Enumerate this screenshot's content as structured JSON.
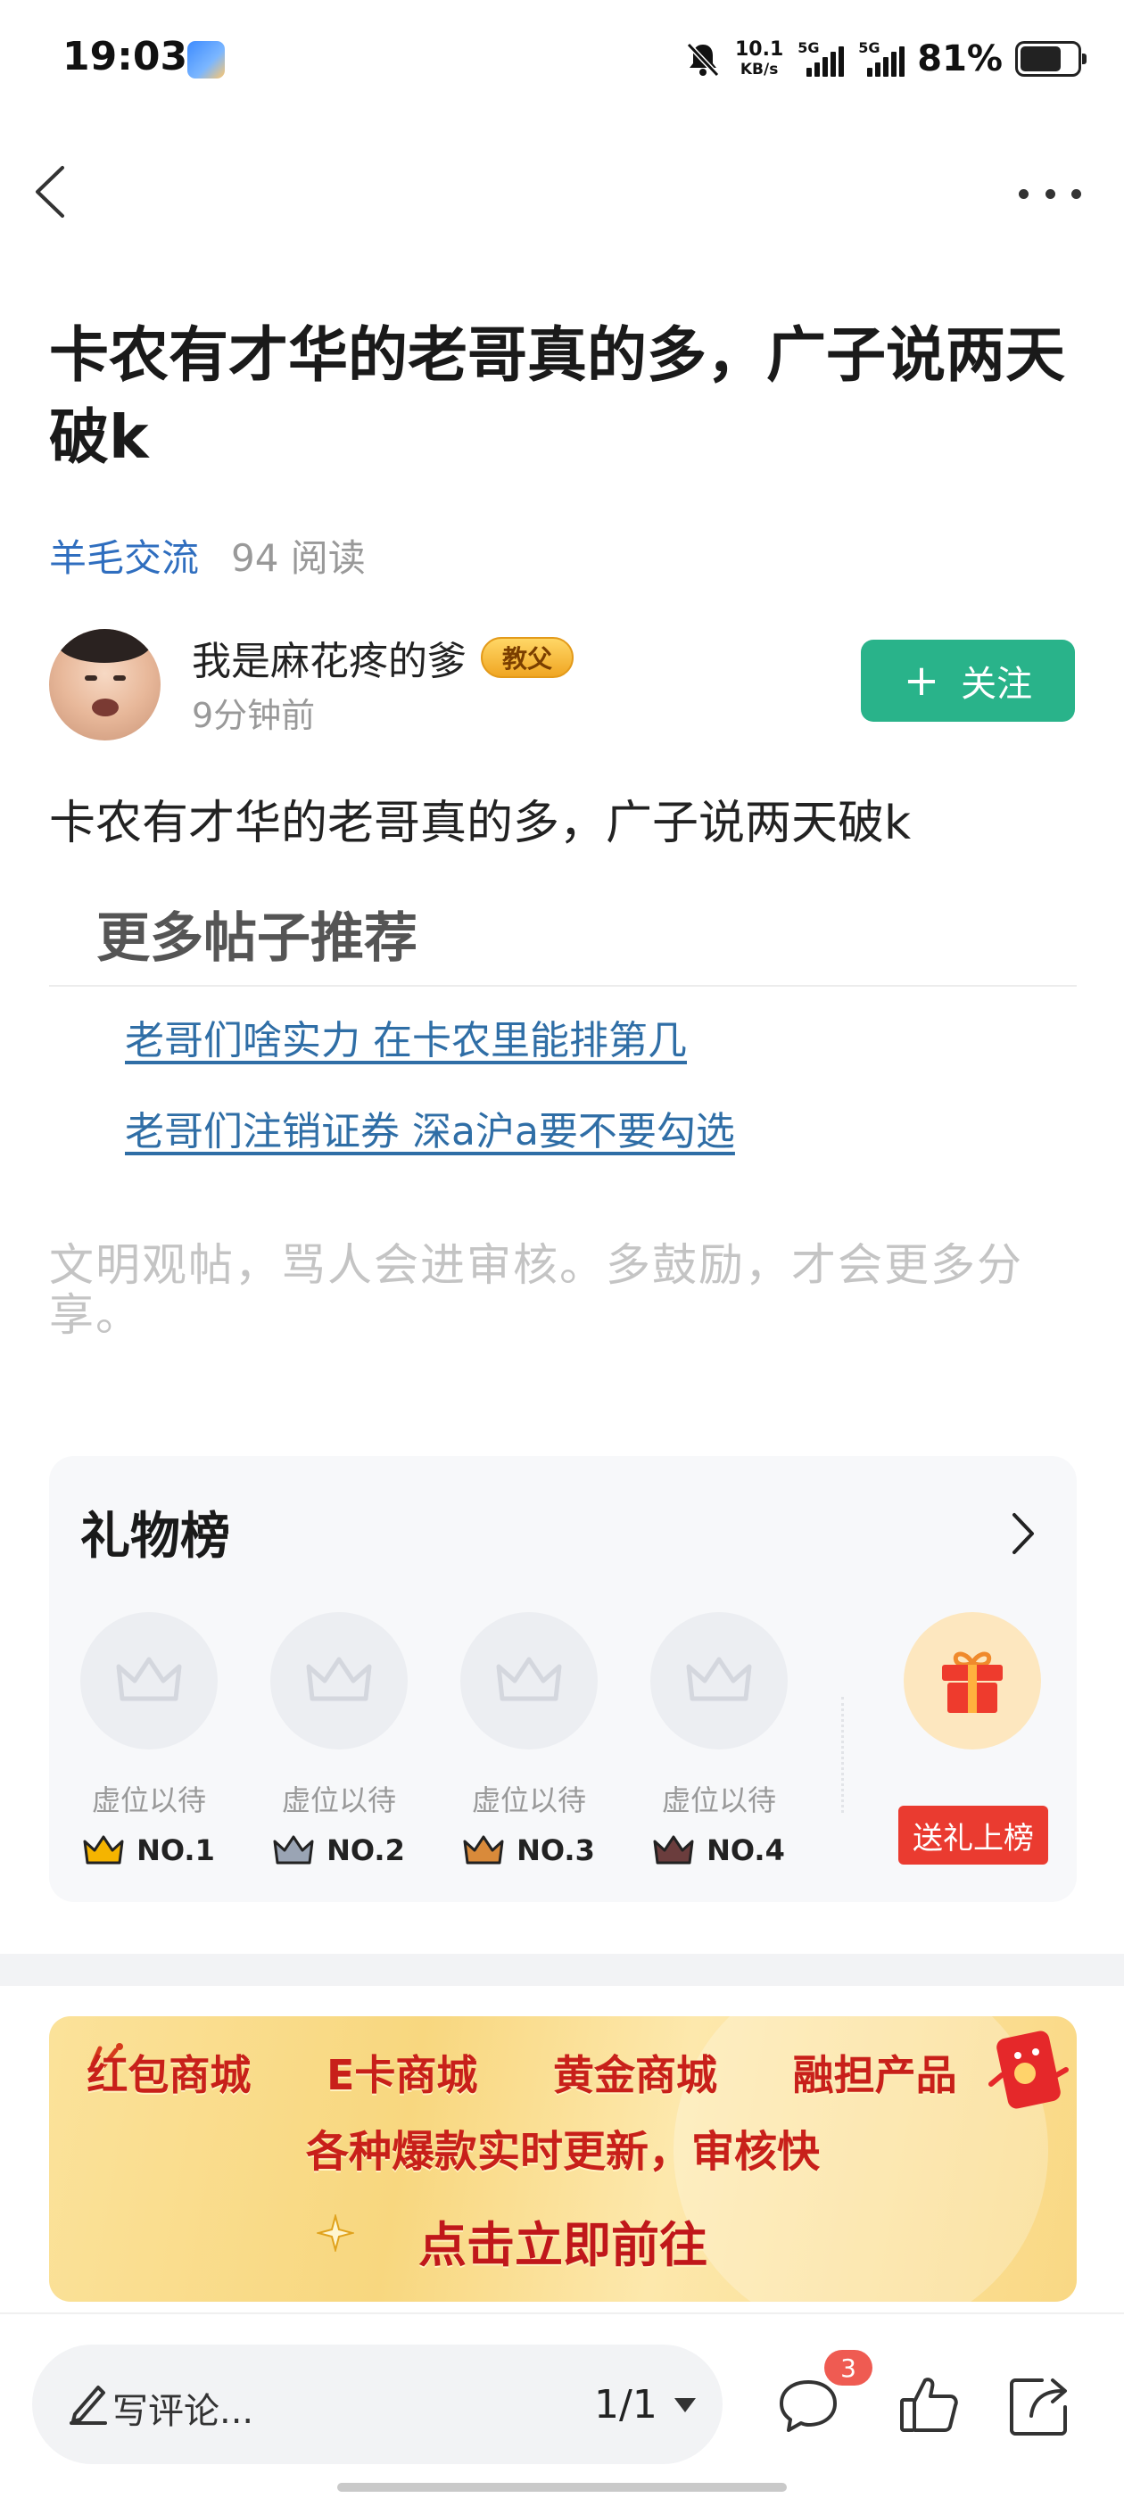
{
  "status_bar": {
    "time": "19:03",
    "net_speed_value": "10.1",
    "net_speed_unit": "KB/s",
    "sig1_label": "5G",
    "sig2_label": "5G",
    "battery_percent": "81%",
    "battery_level": 0.81,
    "icons": [
      "bell-muted-icon",
      "signal-icon",
      "battery-icon"
    ]
  },
  "article": {
    "title": "卡农有才华的老哥真的多，广子说两天破k",
    "category": "羊毛交流",
    "reads": "94 阅读",
    "author": {
      "name": "我是麻花疼的爹",
      "badge": "教父",
      "time": "9分钟前",
      "follow_label": "关注"
    },
    "body": "卡农有才华的老哥真的多，广子说两天破k"
  },
  "more_posts": {
    "heading": "更多帖子推荐",
    "links": [
      "老哥们啥实力 在卡农里能排第几",
      "老哥们注销证券 深a沪a要不要勾选"
    ]
  },
  "notice": "文明观帖，骂人会进审核。多鼓励，才会更多分享。",
  "gift_board": {
    "title": "礼物榜",
    "slots": [
      {
        "label": "虚位以待",
        "rank": "NO.1",
        "crown_color": "#f5b400"
      },
      {
        "label": "虚位以待",
        "rank": "NO.2",
        "crown_color": "#9aa4b4"
      },
      {
        "label": "虚位以待",
        "rank": "NO.3",
        "crown_color": "#d98a3a"
      },
      {
        "label": "虚位以待",
        "rank": "NO.4",
        "crown_color": "#6b3d3d"
      }
    ],
    "gift_button": "送礼上榜"
  },
  "banner": {
    "row1": [
      "红包商城",
      "E卡商城",
      "黄金商城",
      "融担产品"
    ],
    "row2": "各种爆款实时更新，审核快",
    "row3": "点击立即前往"
  },
  "bottom_bar": {
    "comment_placeholder": "写评论...",
    "page_indicator": "1/1",
    "comment_count": "3"
  },
  "colors": {
    "link": "#2f6ea6",
    "category": "#2f6ebf",
    "follow_button": "#29b38a",
    "gift_button": "#ea3b30",
    "badge_red": "#ef5b52"
  }
}
